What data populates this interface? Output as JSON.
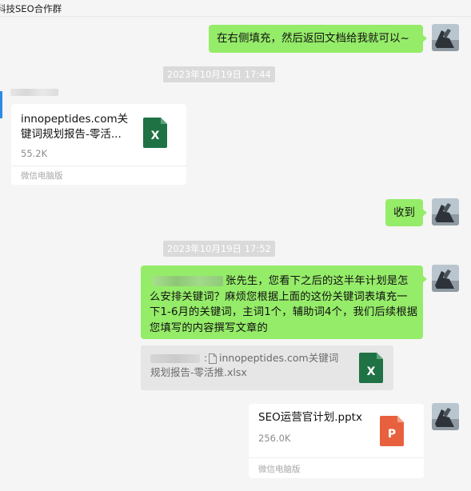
{
  "window": {
    "title": "科技SEO合作群"
  },
  "messages": {
    "m1_text": "在右侧填充，然后返回文档给我就可以~",
    "time1": "2023年10月19日 17:44",
    "file1": {
      "name": "innopeptides.com关键词规划报告-零活...",
      "size": "55.2K",
      "source": "微信电脑版",
      "icon_letter": "X"
    },
    "m2_text": "收到",
    "time2": "2023年10月19日 17:52",
    "m3_text": "张先生，您看下之后的这半年计划是怎么安排关键词？麻烦您根据上面的这份关键词表填充一下1-6月的关键词，主词1个，辅助词4个，我们后续根据您填写的内容撰写文章的",
    "quote": {
      "sep": ":",
      "name": "innopeptides.com关键词规划报告-零活推.xlsx",
      "icon_letter": "X"
    },
    "file2": {
      "name": "SEO运营官计划.pptx",
      "size": "256.0K",
      "source": "微信电脑版",
      "icon_letter": "P"
    }
  },
  "colors": {
    "bubble": "#95ec69",
    "excel": "#1f7244",
    "ppt": "#e8613f"
  },
  "icons": {
    "excel": "excel-file-icon",
    "ppt": "powerpoint-file-icon",
    "doc": "document-icon"
  }
}
